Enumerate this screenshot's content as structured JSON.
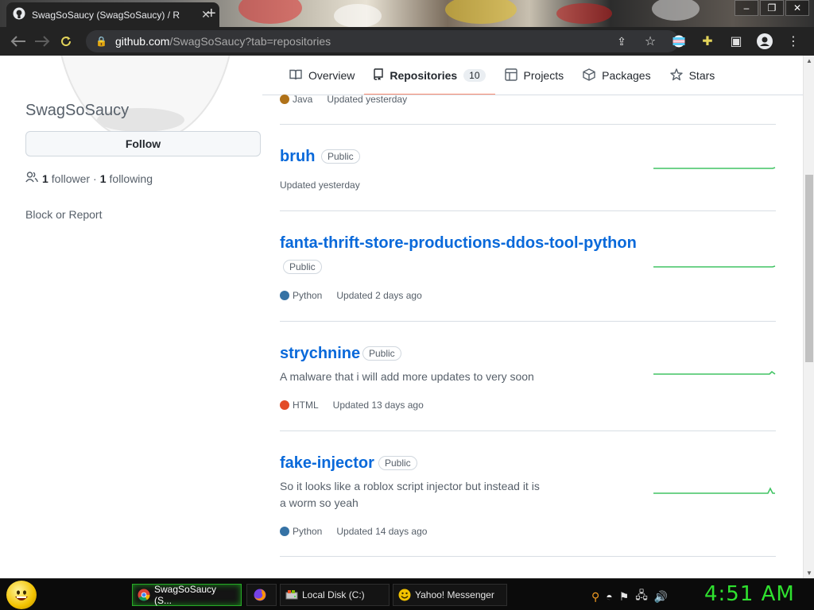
{
  "browser": {
    "tab_title": "SwagSoSaucy (SwagSoSaucy) / R",
    "url_host": "github.com",
    "url_path": "/SwagSoSaucy?tab=repositories"
  },
  "profile": {
    "name": "SwagSoSaucy",
    "follow_label": "Follow",
    "followers_count": "1",
    "followers_label": "follower",
    "separator": "·",
    "following_count": "1",
    "following_label": "following",
    "block_report": "Block or Report"
  },
  "nav": {
    "tabs": [
      {
        "label": "Overview",
        "icon": "book-icon"
      },
      {
        "label": "Repositories",
        "icon": "repo-icon",
        "count": "10"
      },
      {
        "label": "Projects",
        "icon": "table-icon"
      },
      {
        "label": "Packages",
        "icon": "package-icon"
      },
      {
        "label": "Stars",
        "icon": "star-icon"
      }
    ]
  },
  "repos": [
    {
      "language": "Java",
      "language_color": "#b07219",
      "updated": "Updated yesterday"
    },
    {
      "name": "bruh",
      "visibility": "Public",
      "updated": "Updated yesterday"
    },
    {
      "name": "fanta-thrift-store-productions-ddos-tool-python",
      "visibility": "Public",
      "language": "Python",
      "language_color": "#3572A5",
      "updated": "Updated 2 days ago"
    },
    {
      "name": "strychnine",
      "visibility": "Public",
      "description": "A malware that i will add more updates to very soon",
      "language": "HTML",
      "language_color": "#e34c26",
      "updated": "Updated 13 days ago"
    },
    {
      "name": "fake-injector",
      "visibility": "Public",
      "description": "So it looks like a roblox script injector but instead it is a worm so yeah",
      "language": "Python",
      "language_color": "#3572A5",
      "updated": "Updated 14 days ago"
    }
  ],
  "taskbar": {
    "tasks": [
      {
        "label": "SwagSoSaucy (S...",
        "icon": "chrome-icon"
      },
      {
        "label": "",
        "icon": "firefox-icon"
      },
      {
        "label": "Local Disk (C:)",
        "icon": "drive-icon"
      },
      {
        "label": "Yahoo! Messenger",
        "icon": "smiley-icon"
      }
    ],
    "clock": "4:51 AM"
  },
  "colors": {
    "link": "#0969da",
    "accent_underline": "#fd8c73",
    "spark_green": "#40c463",
    "clock_green": "#2fe12f"
  }
}
